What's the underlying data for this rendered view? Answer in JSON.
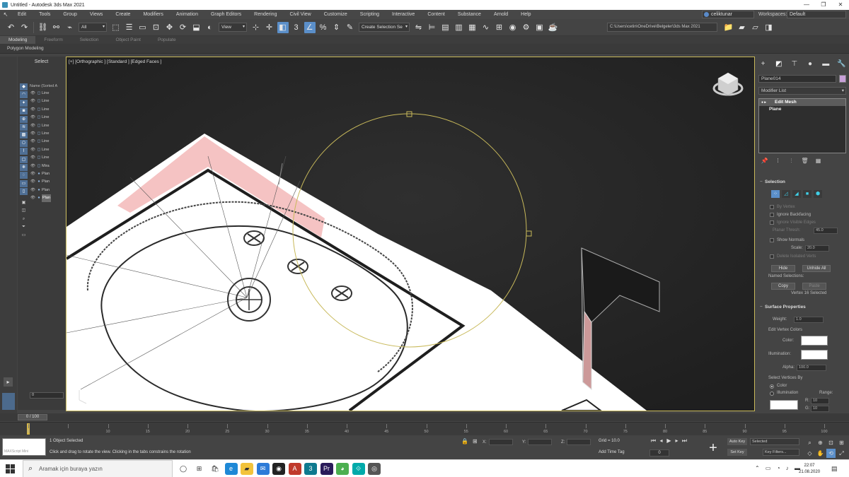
{
  "window": {
    "title": "Untitled - Autodesk 3ds Max 2021",
    "controls": [
      "—",
      "❐",
      "✕"
    ]
  },
  "menubar": {
    "items": [
      "Edit",
      "Tools",
      "Group",
      "Views",
      "Create",
      "Modifiers",
      "Animation",
      "Graph Editors",
      "Rendering",
      "Civil View",
      "Customize",
      "Scripting",
      "Interactive",
      "Content",
      "Substance",
      "Arnold",
      "Help"
    ],
    "user": "celiktunar",
    "workspaces_label": "Workspaces:",
    "workspace_value": "Default"
  },
  "toolbar": {
    "selection_filter": "All",
    "view_dropdown": "View",
    "create_selection_set": "Create Selection Se",
    "project_path": "C:\\Users\\cetin\\OneDrive\\Belgeler\\3ds Max 2021"
  },
  "ribbon": {
    "tabs": [
      "Modeling",
      "Freeform",
      "Selection",
      "Object Paint",
      "Populate"
    ],
    "active_tab": "Modeling",
    "subtitle": "Polygon Modeling"
  },
  "scene_explorer": {
    "title": "Select",
    "header": "Name (Sorted A",
    "rows": [
      {
        "icon": "◻",
        "label": "Line"
      },
      {
        "icon": "◻",
        "label": "Line"
      },
      {
        "icon": "◻",
        "label": "Line"
      },
      {
        "icon": "◻",
        "label": "Line"
      },
      {
        "icon": "◻",
        "label": "Line"
      },
      {
        "icon": "◻",
        "label": "Line"
      },
      {
        "icon": "◻",
        "label": "Line"
      },
      {
        "icon": "◻",
        "label": "Line"
      },
      {
        "icon": "◻",
        "label": "Line"
      },
      {
        "icon": "◻",
        "label": "Mira"
      },
      {
        "icon": "●",
        "label": "Plan"
      },
      {
        "icon": "●",
        "label": "Plan"
      },
      {
        "icon": "●",
        "label": "Plan"
      },
      {
        "icon": "●",
        "label": "Plan"
      }
    ],
    "selected_index": 13,
    "bottom_field": "0"
  },
  "viewport": {
    "label": "[+] [Orthographic ] [Standard ] [Edged Faces ]"
  },
  "command_panel": {
    "object_name": "Plane014",
    "object_color": "#c8a0d8",
    "modifier_list": "Modifier List",
    "stack": {
      "modifier": "Edit Mesh",
      "sub": "Plane"
    },
    "selection": {
      "title": "Selection",
      "by_vertex": "By Vertex",
      "ignore_backfacing": "Ignore Backfacing",
      "ignore_visible_edges": "Ignore Visible Edges",
      "planar_thresh": "Planar Thresh:",
      "planar_value": "45.0",
      "show_normals": "Show Normals",
      "scale_label": "Scale:",
      "scale_value": "20.0",
      "delete_isolated": "Delete Isolated Verts",
      "hide": "Hide",
      "unhide_all": "Unhide All",
      "named_selections": "Named Selections:",
      "copy": "Copy",
      "paste": "Paste",
      "status": "Vertex 16 Selected"
    },
    "surface": {
      "title": "Surface Properties",
      "weight_label": "Weight:",
      "weight_value": "1.0",
      "edit_vertex_colors": "Edit Vertex Colors",
      "color_label": "Color:",
      "illumination_label": "Illumination:",
      "alpha_label": "Alpha:",
      "alpha_value": "100.0",
      "select_vertices_by": "Select Vertices By",
      "color_radio": "Color",
      "illumination_radio": "Illumination",
      "range_label": "Range:",
      "range_r": "R:",
      "range_g": "G:",
      "range_r_value": "10",
      "range_g_value": "10"
    }
  },
  "timeline": {
    "frame_box": "0 / 100",
    "labels": [
      "0",
      "10",
      "15",
      "20",
      "25",
      "30",
      "35",
      "40",
      "45",
      "50",
      "55",
      "60",
      "65",
      "70",
      "75",
      "80",
      "85",
      "90",
      "95",
      "100"
    ],
    "current": 0
  },
  "statusbar": {
    "thumb_label": "MAXScript Mini",
    "selected": "1 Object Selected",
    "message": "Click and drag to rotate the view.  Clicking in the tabs constrains the rotation",
    "x_label": "X:",
    "y_label": "Y:",
    "z_label": "Z:",
    "grid": "Grid = 10.0",
    "add_time_tag": "Add Time Tag",
    "frame": "0",
    "auto_key": "Auto Key",
    "set_key": "Set Key",
    "selected_dropdown": "Selected",
    "key_filters": "Key Filters..."
  },
  "taskbar": {
    "search_placeholder": "Aramak için buraya yazın",
    "time": "22:07",
    "date": "21.08.2020"
  }
}
